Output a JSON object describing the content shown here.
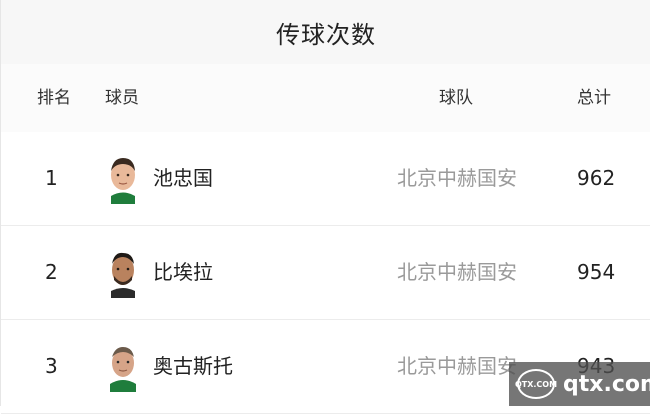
{
  "title": "传球次数",
  "headers": {
    "rank": "排名",
    "player": "球员",
    "team": "球队",
    "total": "总计"
  },
  "rows": [
    {
      "rank": "1",
      "name": "池忠国",
      "team": "北京中赫国安",
      "total": "962"
    },
    {
      "rank": "2",
      "name": "比埃拉",
      "team": "北京中赫国安",
      "total": "954"
    },
    {
      "rank": "3",
      "name": "奥古斯托",
      "team": "北京中赫国安",
      "total": "943"
    }
  ],
  "watermark": {
    "logo_text": "QTX.COM",
    "site": "qtx.com"
  },
  "colors": {
    "header_bg": "#f7f7f7",
    "team_text": "#9a9a9a",
    "divider": "#ececec"
  }
}
